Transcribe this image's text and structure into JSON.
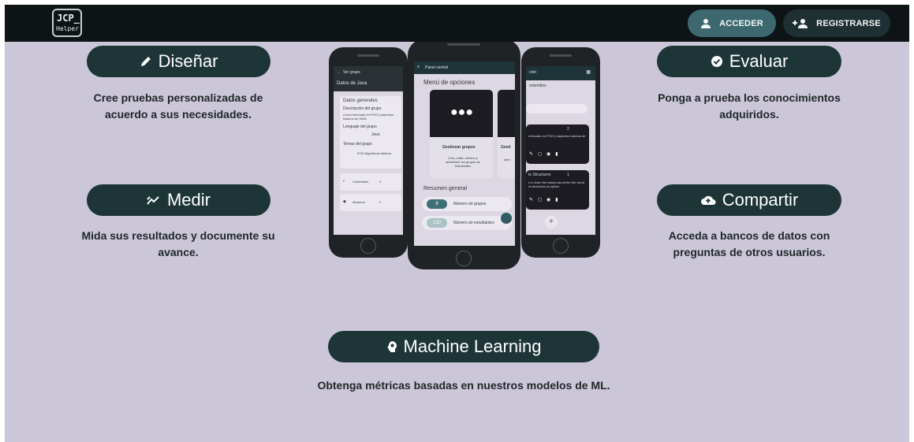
{
  "header": {
    "logo_line1": "JCP_",
    "logo_line2": "Helper",
    "login_label": "ACCEDER",
    "register_label": "REGISTRARSE"
  },
  "features": {
    "design": {
      "title": "Diseñar",
      "description_l1": "Cree pruebas personalizadas de",
      "description_l2": "acuerdo a sus necesidades.",
      "icon": "pencil-icon"
    },
    "evaluate": {
      "title": "Evaluar",
      "description_l1": "Ponga a prueba los conocimientos",
      "description_l2": "adquiridos.",
      "icon": "check-circle-icon"
    },
    "measure": {
      "title": "Medir",
      "description_l1": "Mida sus resultados y documente su",
      "description_l2": "avance.",
      "icon": "trend-icon"
    },
    "share": {
      "title": "Compartir",
      "description_l1": "Acceda a bancos de datos con",
      "description_l2": "preguntas de otros usuarios.",
      "icon": "cloud-upload-icon"
    },
    "ml": {
      "title": "Machine Learning",
      "description": "Obtenga métricas basadas en nuestros modelos de ML.",
      "icon": "brain-icon"
    }
  },
  "mockup": {
    "left": {
      "nav": "Ver grupo",
      "title": "Datos de Java",
      "section": "Datos generales",
      "desc_label": "Descripción del grupo",
      "desc_value": "Curso enfocado en POO y aspectos básicos de JAVA",
      "lang_label": "Lenguaje del grupo",
      "lang_value": "Java",
      "topics_label": "Temas del grupo",
      "topic": "POO Algoritmos básicos",
      "contents_label": "Contenidos",
      "contents_count": "3",
      "students_label": "Alumnos",
      "students_count": "2"
    },
    "center": {
      "nav": "Panel central",
      "menu_title": "Menú de opciones",
      "card_title": "Gestionar grupos",
      "card_desc": "Cree, edite, elimine y administre los grupos de estudiantes",
      "card2_title": "Gesti",
      "card2_desc": "adm",
      "summary_title": "Resumen general",
      "groups_value": "8",
      "groups_label": "Número de grupos",
      "students_value": "120",
      "students_label": "Número de estudiantes"
    },
    "right": {
      "nav": "ción",
      "sub": "ontenidos",
      "item1_text": "enfocado en POO y aspectos básicos de",
      "item1_meta": "2",
      "item2_label": "to Structures",
      "item2_text": "n to learn the basics about the the world of structures in python",
      "item2_meta": "1"
    }
  }
}
